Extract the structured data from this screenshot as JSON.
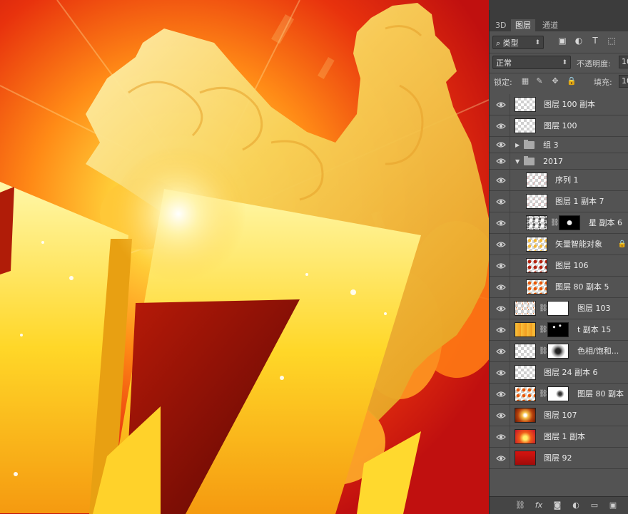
{
  "panel": {
    "tabs": [
      "3D",
      "图层",
      "通道"
    ],
    "active_tab": "图层",
    "filter": {
      "kind_label": "类型"
    },
    "blend": {
      "mode": "正常",
      "opacity_label": "不透明度:",
      "opacity_value": "10"
    },
    "lock": {
      "label": "锁定:",
      "fill_label": "填充:",
      "fill_value": "10"
    },
    "layers": [
      {
        "name": "图层 100 副本",
        "type": "layer",
        "thumb": "transparent"
      },
      {
        "name": "图层 100",
        "type": "layer",
        "thumb": "transparent"
      },
      {
        "name": "组 3",
        "type": "group",
        "expanded": false
      },
      {
        "name": "2017",
        "type": "group",
        "expanded": true
      },
      {
        "name": "序列 1",
        "type": "layer",
        "indent": true,
        "thumb": "pinkspecks"
      },
      {
        "name": "图层 1 副本 7",
        "type": "layer",
        "indent": true,
        "thumb": "pinkspecks"
      },
      {
        "name": "星 副本 6",
        "type": "layer",
        "indent": true,
        "thumb": "stars",
        "mask": "black-stars"
      },
      {
        "name": "矢量智能对象",
        "type": "smart",
        "indent": true,
        "thumb": "gold",
        "locked": true
      },
      {
        "name": "图层 106",
        "type": "layer",
        "indent": true,
        "thumb": "redspot"
      },
      {
        "name": "图层 80 副本 5",
        "type": "layer",
        "indent": true,
        "thumb": "orangespot"
      },
      {
        "name": "图层 103",
        "type": "layer",
        "thumb": "specks",
        "mask": "white"
      },
      {
        "name": "t 副本 15",
        "type": "layer",
        "thumb": "goldtext",
        "mask": "black-specks"
      },
      {
        "name": "色相/饱和...",
        "type": "adjustment",
        "thumb": "transparent",
        "mask": "radial"
      },
      {
        "name": "图层 24 副本 6",
        "type": "layer",
        "thumb": "transparent"
      },
      {
        "name": "图层 80 副本",
        "type": "layer",
        "thumb": "orangespot",
        "mask": "white-soft"
      },
      {
        "name": "图层 107",
        "type": "layer",
        "thumb": "burst"
      },
      {
        "name": "图层 1 副本",
        "type": "layer",
        "thumb": "glow"
      },
      {
        "name": "图层 92",
        "type": "layer",
        "thumb": "red"
      }
    ],
    "bottom_icons": [
      "link-icon",
      "fx-icon",
      "add-mask-icon",
      "adjustment-icon",
      "new-group-icon",
      "new-layer-icon"
    ]
  },
  "colors": {
    "panel_bg": "#535353",
    "tabbar_bg": "#3c3c3c",
    "text": "#ececec",
    "canvas_red": "#c51410",
    "gold": "#f6c43a"
  }
}
